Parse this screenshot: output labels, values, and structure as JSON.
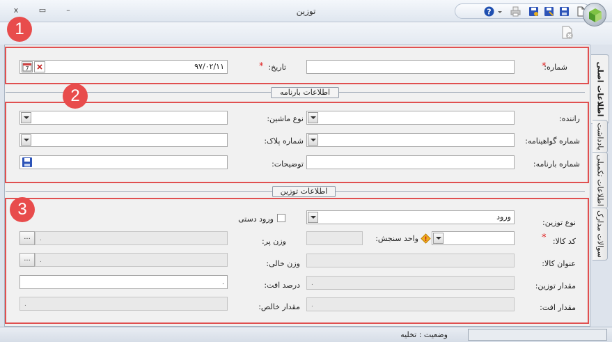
{
  "window": {
    "title": "توزین",
    "close_glyph": "x",
    "restore_glyph": "▭",
    "minimize_glyph": "–"
  },
  "qat_icons": [
    "new-document-icon",
    "save-icon",
    "save-as-icon",
    "save-all-icon",
    "print-icon",
    "dropdown-icon",
    "help-icon"
  ],
  "tabs": [
    {
      "label": "اطلاعات اصلی",
      "active": true
    },
    {
      "label": "یادداشت",
      "active": false
    },
    {
      "label": "اطلاعات تکمیلی",
      "active": false
    },
    {
      "label": "سوالات مدارک",
      "active": false
    }
  ],
  "badges": [
    "1",
    "2",
    "3"
  ],
  "section1": {
    "number_label": "شماره:",
    "number_value": "",
    "date_label": "تاریخ:",
    "date_value": "۹۷/۰۲/۱۱",
    "required_mark": "*"
  },
  "section2": {
    "header": "اطلاعات بارنامه",
    "driver_label": "راننده:",
    "vehicle_type_label": "نوع ماشین:",
    "license_number_label": "شماره گواهینامه:",
    "plate_number_label": "شماره پلاک:",
    "waybill_number_label": "شماره بارنامه:",
    "description_label": "توضیحات:"
  },
  "section3": {
    "header": "اطلاعات توزین",
    "weigh_type_label": "نوع توزین:",
    "weigh_type_value": "ورود",
    "manual_entry_label": "ورود دستی",
    "item_code_label": "کد کالا:",
    "unit_label": "واحد سنجش:",
    "full_weight_label": "وزن پر:",
    "item_title_label": "عنوان کالا:",
    "empty_weight_label": "وزن خالی:",
    "weigh_amount_label": "مقدار توزین:",
    "loss_percent_label": "درصد افت:",
    "loss_amount_label": "مقدار افت:",
    "net_amount_label": "مقدار خالص:",
    "numeric_placeholder": "۰",
    "ellipsis": "...",
    "required_mark": "*"
  },
  "status": {
    "label": "وضعیت : تخلیه"
  },
  "colors": {
    "highlight": "#e05050",
    "badge": "#e84c4c"
  }
}
